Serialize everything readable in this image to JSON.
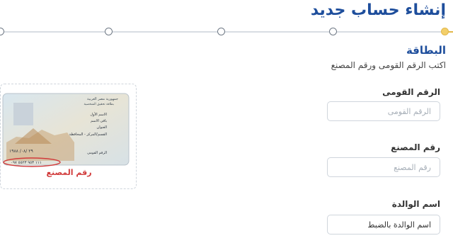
{
  "header": {
    "title": "إنشاء حساب جديد"
  },
  "stepper": {
    "total_steps": 5,
    "current_step": 1
  },
  "section": {
    "title": "البطاقة",
    "subtitle": "اكتب الرقم القومى ورقم المصنع"
  },
  "fields": {
    "national_id": {
      "label": "الرقم القومى",
      "placeholder": "الرقم القومى"
    },
    "factory_number": {
      "label": "رقم المصنع",
      "placeholder": "رقم المصنع"
    },
    "mother_name": {
      "label": "اسم الوالدة",
      "value": "اسم الوالدة بالضبط"
    }
  },
  "id_card": {
    "caption": "رقم المصنع",
    "header_line1": "جمهورية مصر العربية",
    "header_line2": "بطاقة تحقيق الشخصية",
    "lines": [
      "الاسم الأول",
      "باقى الاسم",
      "العنوان",
      "القسم/المركز - المحافظة"
    ],
    "national_id_label": "الرقم القومى",
    "id_digits": "٢٩ /٠٨/ ١٩٨٨",
    "factory_code": "١١١ ٩٥٣ ٥٥٢٣ ٠٩٧"
  },
  "colors": {
    "title": "#1e4e9c",
    "accent": "#e2b84b",
    "caption": "#d13b3b"
  }
}
